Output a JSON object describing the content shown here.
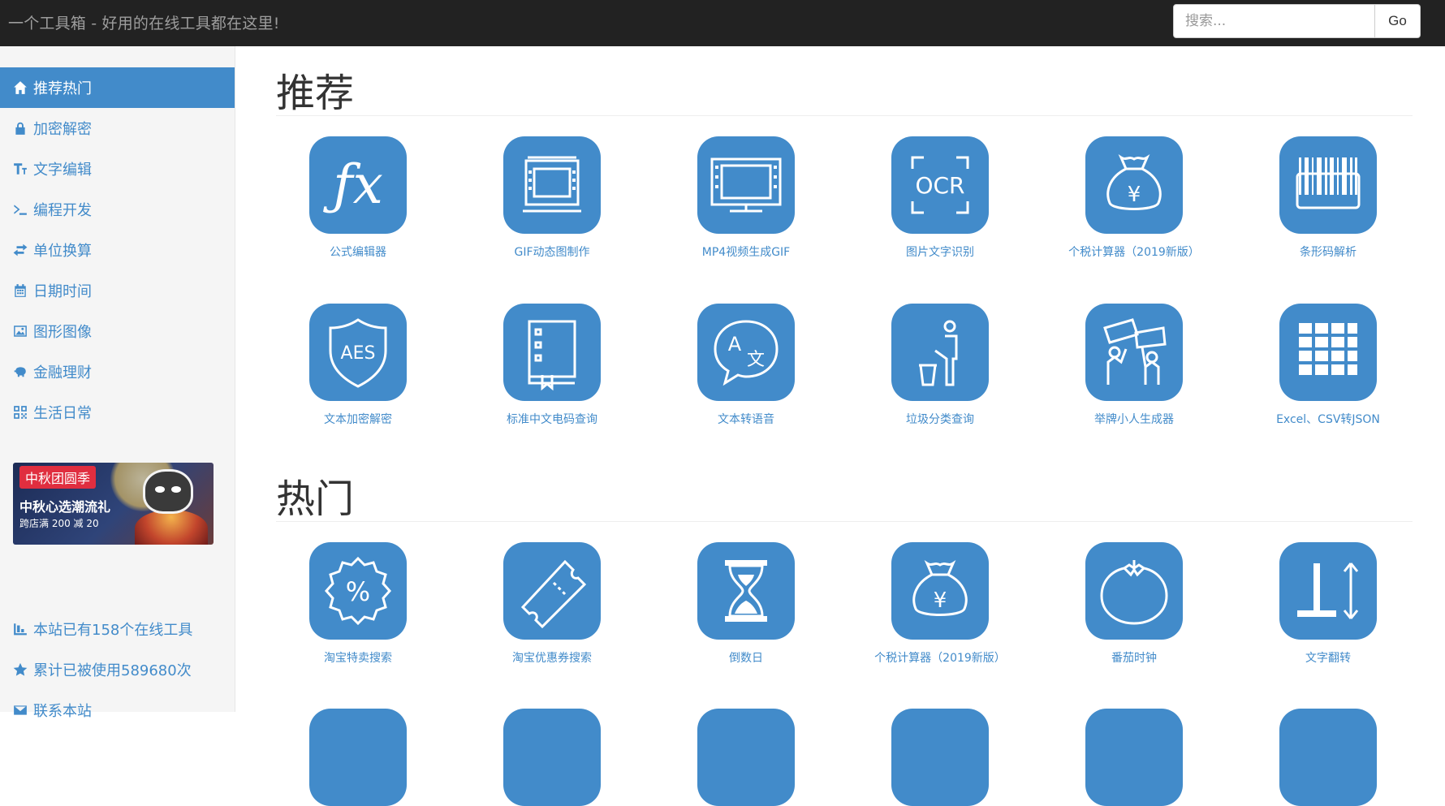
{
  "header": {
    "title": "一个工具箱 - 好用的在线工具都在这里!",
    "search_placeholder": "搜索...",
    "go_label": "Go"
  },
  "sidebar": {
    "items": [
      {
        "label": "推荐热门",
        "icon": "home-icon",
        "active": true
      },
      {
        "label": "加密解密",
        "icon": "lock-icon"
      },
      {
        "label": "文字编辑",
        "icon": "text-height-icon"
      },
      {
        "label": "编程开发",
        "icon": "terminal-icon"
      },
      {
        "label": "单位换算",
        "icon": "exchange-icon"
      },
      {
        "label": "日期时间",
        "icon": "calendar-icon"
      },
      {
        "label": "图形图像",
        "icon": "picture-icon"
      },
      {
        "label": "金融理财",
        "icon": "piggy-bank-icon"
      },
      {
        "label": "生活日常",
        "icon": "qrcode-icon"
      }
    ],
    "ad": {
      "tag": "中秋团圆季",
      "title": "中秋心选潮流礼",
      "subtitle": "跨店满 200 减 20"
    },
    "stats": [
      {
        "label": "本站已有158个在线工具",
        "icon": "stats-icon"
      },
      {
        "label": "累计已被使用589680次",
        "icon": "star-icon"
      },
      {
        "label": "联系本站",
        "icon": "envelope-icon"
      }
    ]
  },
  "sections": [
    {
      "title": "推荐",
      "tools": [
        {
          "label": "公式编辑器",
          "icon": "function-fx-icon"
        },
        {
          "label": "GIF动态图制作",
          "icon": "film-frame-icon"
        },
        {
          "label": "MP4视频生成GIF",
          "icon": "video-monitor-icon"
        },
        {
          "label": "图片文字识别",
          "icon": "ocr-scan-icon"
        },
        {
          "label": "个税计算器（2019新版）",
          "icon": "money-bag-yen-icon"
        },
        {
          "label": "条形码解析",
          "icon": "barcode-icon"
        },
        {
          "label": "文本加密解密",
          "icon": "aes-shield-icon"
        },
        {
          "label": "标准中文电码查询",
          "icon": "codebook-icon"
        },
        {
          "label": "文本转语音",
          "icon": "translate-bubble-icon"
        },
        {
          "label": "垃圾分类查询",
          "icon": "trash-person-icon"
        },
        {
          "label": "举牌小人生成器",
          "icon": "sign-holders-icon"
        },
        {
          "label": "Excel、CSV转JSON",
          "icon": "spreadsheet-grid-icon"
        }
      ]
    },
    {
      "title": "热门",
      "tools": [
        {
          "label": "淘宝特卖搜索",
          "icon": "discount-badge-icon"
        },
        {
          "label": "淘宝优惠券搜索",
          "icon": "coupon-ticket-icon"
        },
        {
          "label": "倒数日",
          "icon": "hourglass-icon"
        },
        {
          "label": "个税计算器（2019新版）",
          "icon": "money-bag-yen-icon"
        },
        {
          "label": "番茄时钟",
          "icon": "tomato-icon"
        },
        {
          "label": "文字翻转",
          "icon": "text-flip-icon"
        }
      ]
    }
  ]
}
